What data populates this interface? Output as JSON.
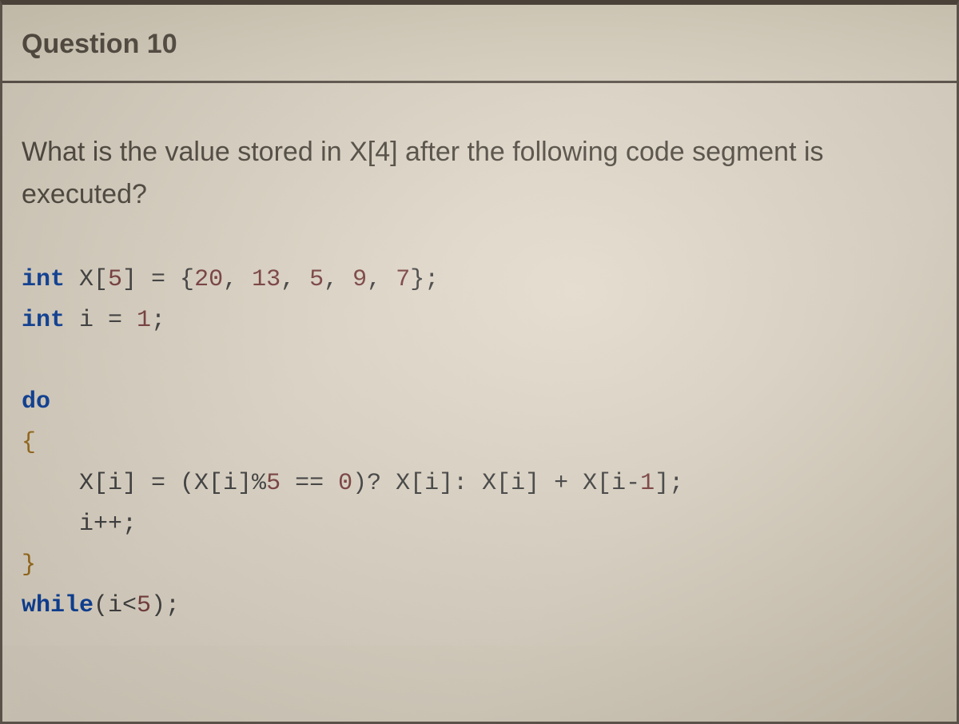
{
  "header": {
    "title": "Question 10"
  },
  "prompt": "What is the value stored in X[4] after the following code segment is executed?",
  "code": {
    "l1_kw": "int",
    "l1_a": " X[",
    "l1_n5": "5",
    "l1_b": "] = {",
    "l1_v1": "20",
    "l1_c1": ", ",
    "l1_v2": "13",
    "l1_c2": ", ",
    "l1_v3": "5",
    "l1_c3": ", ",
    "l1_v4": "9",
    "l1_c4": ", ",
    "l1_v5": "7",
    "l1_d": "};",
    "l2_kw": "int",
    "l2_a": " i = ",
    "l2_n": "1",
    "l2_b": ";",
    "l4_kw": "do",
    "l5": "{",
    "l6_a": "    X[i] = (X[i]%",
    "l6_n5": "5",
    "l6_b": " == ",
    "l6_n0": "0",
    "l6_c": ")? X[i]: X[i] + X[i-",
    "l6_n1": "1",
    "l6_d": "];",
    "l7": "    i++;",
    "l8": "}",
    "l9_kw": "while",
    "l9_a": "(i<",
    "l9_n": "5",
    "l9_b": ");"
  }
}
